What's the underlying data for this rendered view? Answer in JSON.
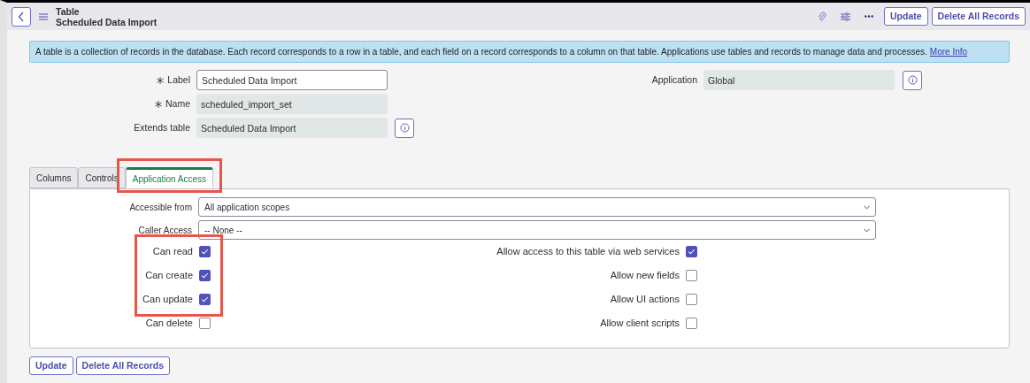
{
  "header": {
    "record_type": "Table",
    "title": "Scheduled Data Import",
    "buttons": [
      "Update",
      "Delete All Records"
    ]
  },
  "info_banner": {
    "text": "A table is a collection of records in the database. Each record corresponds to a row in a table, and each field on a record corresponds to a column on that table. Applications use tables and records to manage data and processes.",
    "link": "More Info"
  },
  "fields": [
    {
      "label": "Label",
      "required": true,
      "value": "Scheduled Data Import",
      "readonly": false
    },
    {
      "label": "Name",
      "required": true,
      "value": "scheduled_import_set",
      "readonly": true
    },
    {
      "label": "Extends table",
      "required": false,
      "value": "Scheduled Data Import",
      "readonly": true
    }
  ],
  "application": {
    "label": "Application",
    "value": "Global"
  },
  "tabs": [
    {
      "label": "Columns",
      "selected": false,
      "highlighted": false
    },
    {
      "label": "Controls",
      "selected": false,
      "highlighted": false
    },
    {
      "label": "Application Access",
      "selected": true,
      "highlighted": true
    }
  ],
  "selects": [
    {
      "label": "Accessible from",
      "value": "All application scopes"
    },
    {
      "label": "Caller Access",
      "value": "-- None --"
    }
  ],
  "checkboxes_left": [
    {
      "label": "Can read",
      "checked": true,
      "highlighted": true
    },
    {
      "label": "Can create",
      "checked": true,
      "highlighted": true
    },
    {
      "label": "Can update",
      "checked": true,
      "highlighted": true
    },
    {
      "label": "Can delete",
      "checked": false,
      "highlighted": false
    }
  ],
  "checkboxes_right": [
    {
      "label": "Allow access to this table via web services",
      "checked": true
    },
    {
      "label": "Allow new fields",
      "checked": false
    },
    {
      "label": "Allow UI actions",
      "checked": false
    },
    {
      "label": "Allow client scripts",
      "checked": false
    }
  ],
  "footer_buttons": [
    "Update",
    "Delete All Records"
  ]
}
